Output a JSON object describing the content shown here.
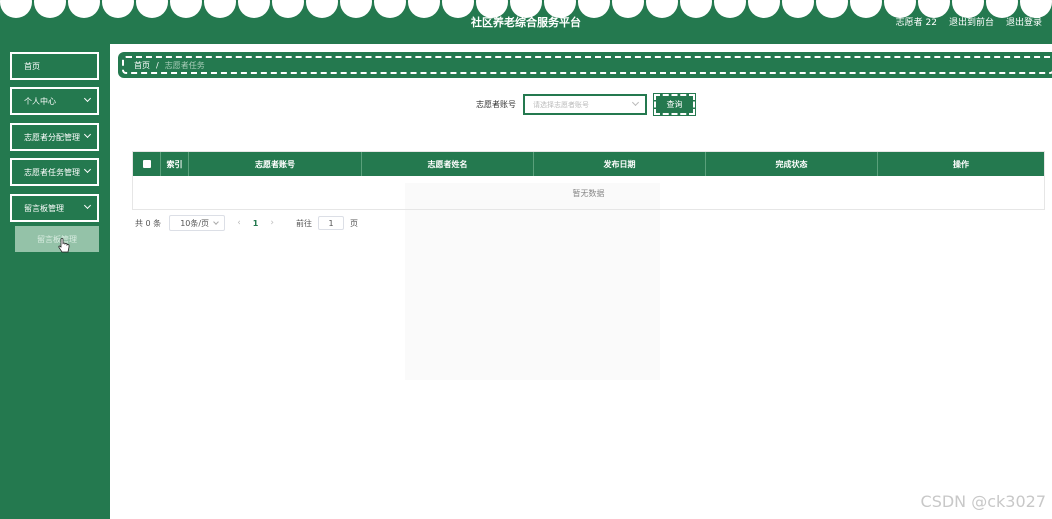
{
  "header": {
    "title": "社区养老综合服务平台",
    "user": "志愿者 22",
    "back_to_front": "退出到前台",
    "logout": "退出登录"
  },
  "sidebar": {
    "items": [
      {
        "label": "首页"
      },
      {
        "label": "个人中心"
      },
      {
        "label": "志愿者分配管理"
      },
      {
        "label": "志愿者任务管理"
      },
      {
        "label": "留言板管理"
      }
    ],
    "sub_item": "留言板管理"
  },
  "breadcrumb": {
    "home": "首页",
    "separator": "/",
    "current": "志愿者任务"
  },
  "search": {
    "label": "志愿者账号",
    "placeholder": "请选择志愿者账号",
    "button": "查询"
  },
  "table": {
    "columns": [
      "索引",
      "志愿者账号",
      "志愿者姓名",
      "发布日期",
      "完成状态",
      "操作"
    ],
    "empty_text": "暂无数据"
  },
  "pagination": {
    "total": "共 0 条",
    "page_size": "10条/页",
    "prev": "‹",
    "current_page": "1",
    "next": "›",
    "goto_label": "前往",
    "goto_value": "1",
    "page_unit": "页"
  },
  "watermark": "CSDN @ck3027",
  "colors": {
    "primary": "#24794f",
    "submenu": "#94c2a8"
  }
}
